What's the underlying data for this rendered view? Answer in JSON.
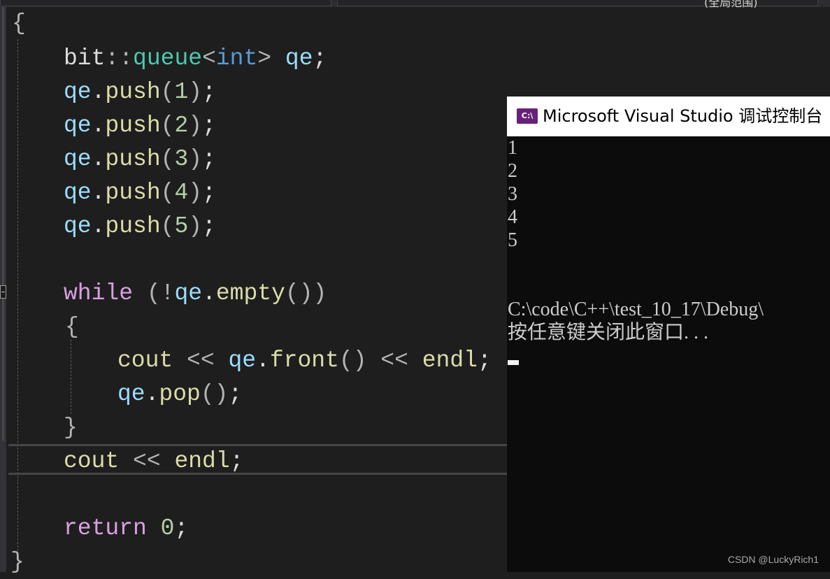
{
  "topbar": {
    "clipped_text": "(全局范围)"
  },
  "editor": {
    "lines": [
      [
        {
          "t": "{",
          "c": "op"
        }
      ],
      [
        {
          "t": "bit",
          "c": "plain"
        },
        {
          "t": "::",
          "c": "op"
        },
        {
          "t": "queue",
          "c": "typ"
        },
        {
          "t": "<",
          "c": "op"
        },
        {
          "t": "int",
          "c": "kw"
        },
        {
          "t": ">",
          "c": "op"
        },
        {
          "t": " ",
          "c": "plain"
        },
        {
          "t": "qe",
          "c": "var"
        },
        {
          "t": ";",
          "c": "plain"
        }
      ],
      [
        {
          "t": "qe",
          "c": "var"
        },
        {
          "t": ".",
          "c": "plain"
        },
        {
          "t": "push",
          "c": "fn"
        },
        {
          "t": "(",
          "c": "op"
        },
        {
          "t": "1",
          "c": "num"
        },
        {
          "t": ")",
          "c": "op"
        },
        {
          "t": ";",
          "c": "plain"
        }
      ],
      [
        {
          "t": "qe",
          "c": "var"
        },
        {
          "t": ".",
          "c": "plain"
        },
        {
          "t": "push",
          "c": "fn"
        },
        {
          "t": "(",
          "c": "op"
        },
        {
          "t": "2",
          "c": "num"
        },
        {
          "t": ")",
          "c": "op"
        },
        {
          "t": ";",
          "c": "plain"
        }
      ],
      [
        {
          "t": "qe",
          "c": "var"
        },
        {
          "t": ".",
          "c": "plain"
        },
        {
          "t": "push",
          "c": "fn"
        },
        {
          "t": "(",
          "c": "op"
        },
        {
          "t": "3",
          "c": "num"
        },
        {
          "t": ")",
          "c": "op"
        },
        {
          "t": ";",
          "c": "plain"
        }
      ],
      [
        {
          "t": "qe",
          "c": "var"
        },
        {
          "t": ".",
          "c": "plain"
        },
        {
          "t": "push",
          "c": "fn"
        },
        {
          "t": "(",
          "c": "op"
        },
        {
          "t": "4",
          "c": "num"
        },
        {
          "t": ")",
          "c": "op"
        },
        {
          "t": ";",
          "c": "plain"
        }
      ],
      [
        {
          "t": "qe",
          "c": "var"
        },
        {
          "t": ".",
          "c": "plain"
        },
        {
          "t": "push",
          "c": "fn"
        },
        {
          "t": "(",
          "c": "op"
        },
        {
          "t": "5",
          "c": "num"
        },
        {
          "t": ")",
          "c": "op"
        },
        {
          "t": ";",
          "c": "plain"
        }
      ],
      [],
      [
        {
          "t": "while",
          "c": "ctl"
        },
        {
          "t": " (",
          "c": "op"
        },
        {
          "t": "!",
          "c": "op"
        },
        {
          "t": "qe",
          "c": "var"
        },
        {
          "t": ".",
          "c": "plain"
        },
        {
          "t": "empty",
          "c": "fn"
        },
        {
          "t": "())",
          "c": "op"
        }
      ],
      [
        {
          "t": "{",
          "c": "op"
        }
      ],
      [
        {
          "t": "cout",
          "c": "fn"
        },
        {
          "t": " << ",
          "c": "op"
        },
        {
          "t": "qe",
          "c": "var"
        },
        {
          "t": ".",
          "c": "plain"
        },
        {
          "t": "front",
          "c": "fn"
        },
        {
          "t": "()",
          "c": "op"
        },
        {
          "t": " << ",
          "c": "op"
        },
        {
          "t": "endl",
          "c": "fn"
        },
        {
          "t": ";",
          "c": "plain"
        }
      ],
      [
        {
          "t": "qe",
          "c": "var"
        },
        {
          "t": ".",
          "c": "plain"
        },
        {
          "t": "pop",
          "c": "fn"
        },
        {
          "t": "()",
          "c": "op"
        },
        {
          "t": ";",
          "c": "plain"
        }
      ],
      [
        {
          "t": "}",
          "c": "op"
        }
      ],
      [
        {
          "t": "cout",
          "c": "fn"
        },
        {
          "t": " << ",
          "c": "op"
        },
        {
          "t": "endl",
          "c": "fn"
        },
        {
          "t": ";",
          "c": "plain"
        }
      ],
      [],
      [
        {
          "t": "return",
          "c": "ctl"
        },
        {
          "t": " ",
          "c": "plain"
        },
        {
          "t": "0",
          "c": "num"
        },
        {
          "t": ";",
          "c": "plain"
        }
      ],
      [
        {
          "t": "}",
          "c": "op"
        }
      ]
    ]
  },
  "console": {
    "title": "Microsoft Visual Studio 调试控制台",
    "icon_label": "C:\\",
    "icon": "console-app-icon",
    "output": [
      "1",
      "2",
      "3",
      "4",
      "5",
      "",
      "",
      "C:\\code\\C++\\test_10_17\\Debug\\",
      "按任意键关闭此窗口. . ."
    ]
  },
  "watermark": "CSDN @LuckyRich1"
}
